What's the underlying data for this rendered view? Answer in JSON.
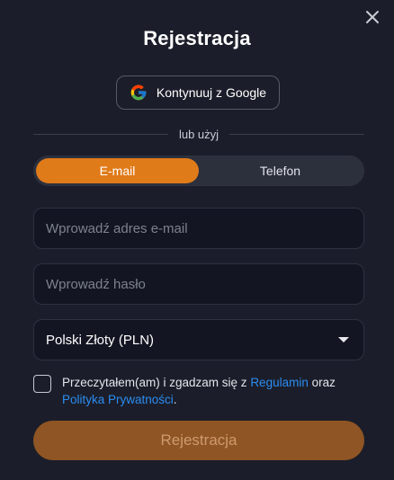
{
  "modal": {
    "title": "Rejestracja"
  },
  "google_button": {
    "label": "Kontynuuj z Google",
    "icon": "google-icon"
  },
  "divider": {
    "text": "lub użyj"
  },
  "tabs": [
    {
      "label": "E-mail",
      "active": true
    },
    {
      "label": "Telefon",
      "active": false
    }
  ],
  "form": {
    "email": {
      "value": "",
      "placeholder": "Wprowadź adres e-mail"
    },
    "password": {
      "value": "",
      "placeholder": "Wprowadź hasło"
    },
    "currency": {
      "value": "Polski Złoty (PLN)"
    }
  },
  "terms": {
    "checked": false,
    "text_before": "Przeczytałem(am) i zgadzam się z ",
    "link1": "Regulamin",
    "text_middle": " oraz ",
    "link2": "Polityka Prywatności",
    "text_after": "."
  },
  "submit": {
    "label": "Rejestracja"
  },
  "colors": {
    "background": "#1b1e2a",
    "accent": "#e07b1a",
    "submit_disabled": "#8f5524",
    "link": "#2c8cf0"
  }
}
